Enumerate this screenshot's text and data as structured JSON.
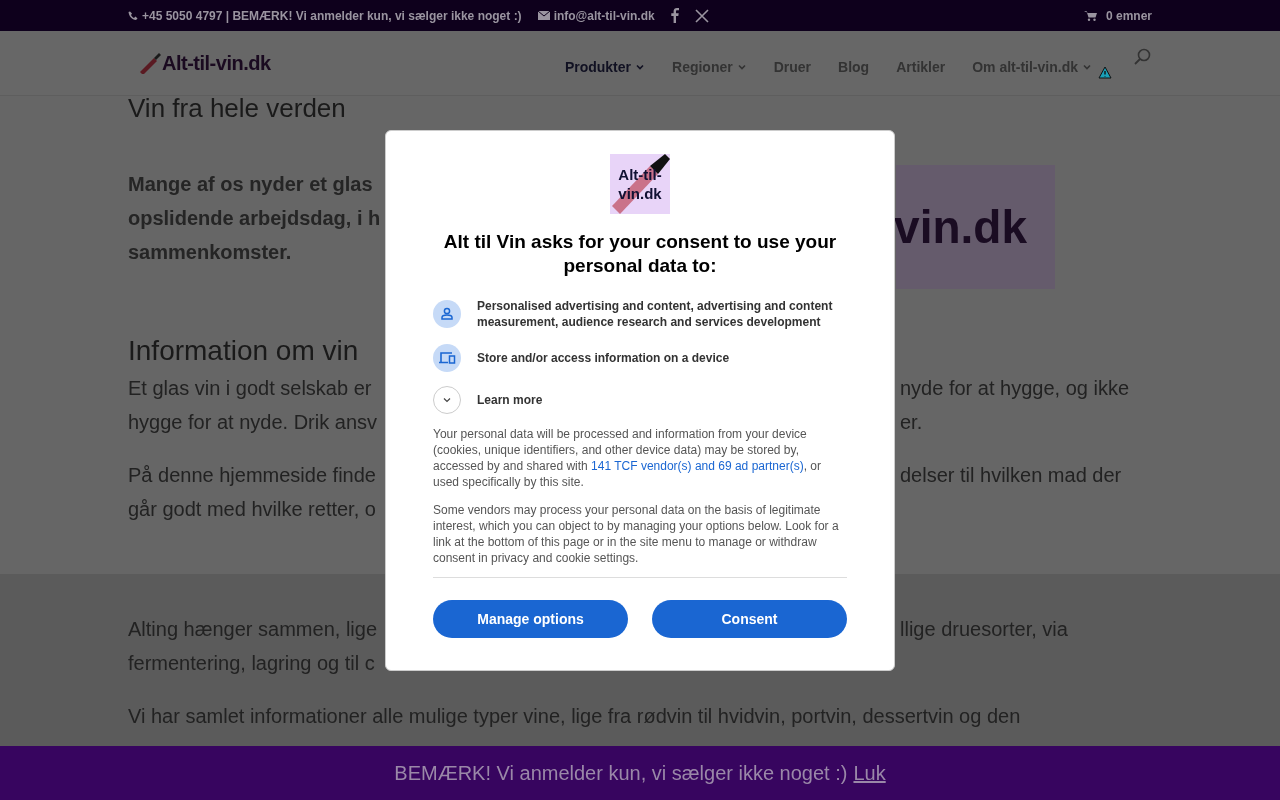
{
  "top_bar": {
    "phone": "+45 5050 4797 | BEMÆRK! Vi anmelder kun, vi sælger ikke noget :)",
    "email": "info@alt-til-vin.dk",
    "cart": "0 emner"
  },
  "header": {
    "logo": "Alt-til-vin.dk",
    "nav": [
      {
        "label": "Produkter",
        "selected": true,
        "dropdown": true
      },
      {
        "label": "Regioner",
        "selected": false,
        "dropdown": true
      },
      {
        "label": "Druer",
        "selected": false,
        "dropdown": false
      },
      {
        "label": "Blog",
        "selected": false,
        "dropdown": false
      },
      {
        "label": "Artikler",
        "selected": false,
        "dropdown": false
      },
      {
        "label": "Om alt-til-vin.dk",
        "selected": false,
        "dropdown": true
      }
    ]
  },
  "content": {
    "heading": "Vin fra hele verden",
    "intro_lines": [
      "Mange af os nyder et glas",
      "opslidende arbejdsdag, i h",
      "sammenkomster."
    ],
    "image_text": "vin.dk",
    "section_heading": "Information om vin",
    "lines": [
      {
        "left": "Et glas vin i godt selskab er",
        "right": "nyde for at hygge, og ikke"
      },
      {
        "left": "hygge for at nyde. Drik ansv",
        "right": "er."
      },
      {
        "left": "På denne hjemmeside finde",
        "right": "delser til hvilken mad der",
        "gap": true
      },
      {
        "left": "går godt med hvilke retter, o"
      }
    ],
    "lower_lines": [
      {
        "left": "Alting hænger sammen, lige",
        "right": "llige druesorter, via"
      },
      {
        "left": "fermentering, lagring og til c"
      }
    ],
    "lower_full": "Vi har samlet informationer alle mulige typer vine, lige fra rødvin til hvidvin, portvin, dessertvin og den"
  },
  "consent": {
    "logo": "Alt-til-vin.dk",
    "title": "Alt til Vin asks for your consent to use your personal data to:",
    "purposes": [
      {
        "kind": "person",
        "text": "Personalised advertising and content, advertising and content measurement, audience research and services development"
      },
      {
        "kind": "device",
        "text": "Store and/or access information on a device"
      },
      {
        "kind": "expand",
        "text": "Learn more"
      }
    ],
    "paragraph_1": {
      "before": "Your personal data will be processed and information from your device (cookies, unique identifiers, and other device data) may be stored by, accessed by and shared with ",
      "link": "141 TCF vendor(s) and 69 ad partner(s)",
      "after": ", or used specifically by this site."
    },
    "paragraph_2": "Some vendors may process your personal data on the basis of legitimate interest, which you can object to by managing your options below. Look for a link at the bottom of this page or in the site menu to manage or withdraw consent in privacy and cookie settings.",
    "buttons": [
      "Manage options",
      "Consent"
    ]
  },
  "notice_bar": {
    "text": "BEMÆRK! Vi anmelder kun, vi sælger ikke noget :)",
    "link": "Luk"
  }
}
